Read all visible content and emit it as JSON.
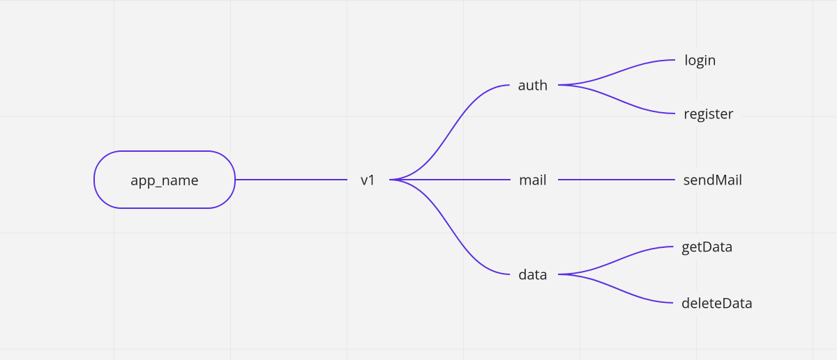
{
  "diagram": {
    "type": "tree",
    "root": {
      "label": "app_name"
    },
    "level1": {
      "label": "v1"
    },
    "level2": [
      {
        "key": "auth",
        "label": "auth"
      },
      {
        "key": "mail",
        "label": "mail"
      },
      {
        "key": "data",
        "label": "data"
      }
    ],
    "level3": {
      "auth": [
        {
          "label": "login"
        },
        {
          "label": "register"
        }
      ],
      "mail": [
        {
          "label": "sendMail"
        }
      ],
      "data": [
        {
          "label": "getData"
        },
        {
          "label": "deleteData"
        }
      ]
    },
    "edge_color": "#5b2ee0"
  }
}
